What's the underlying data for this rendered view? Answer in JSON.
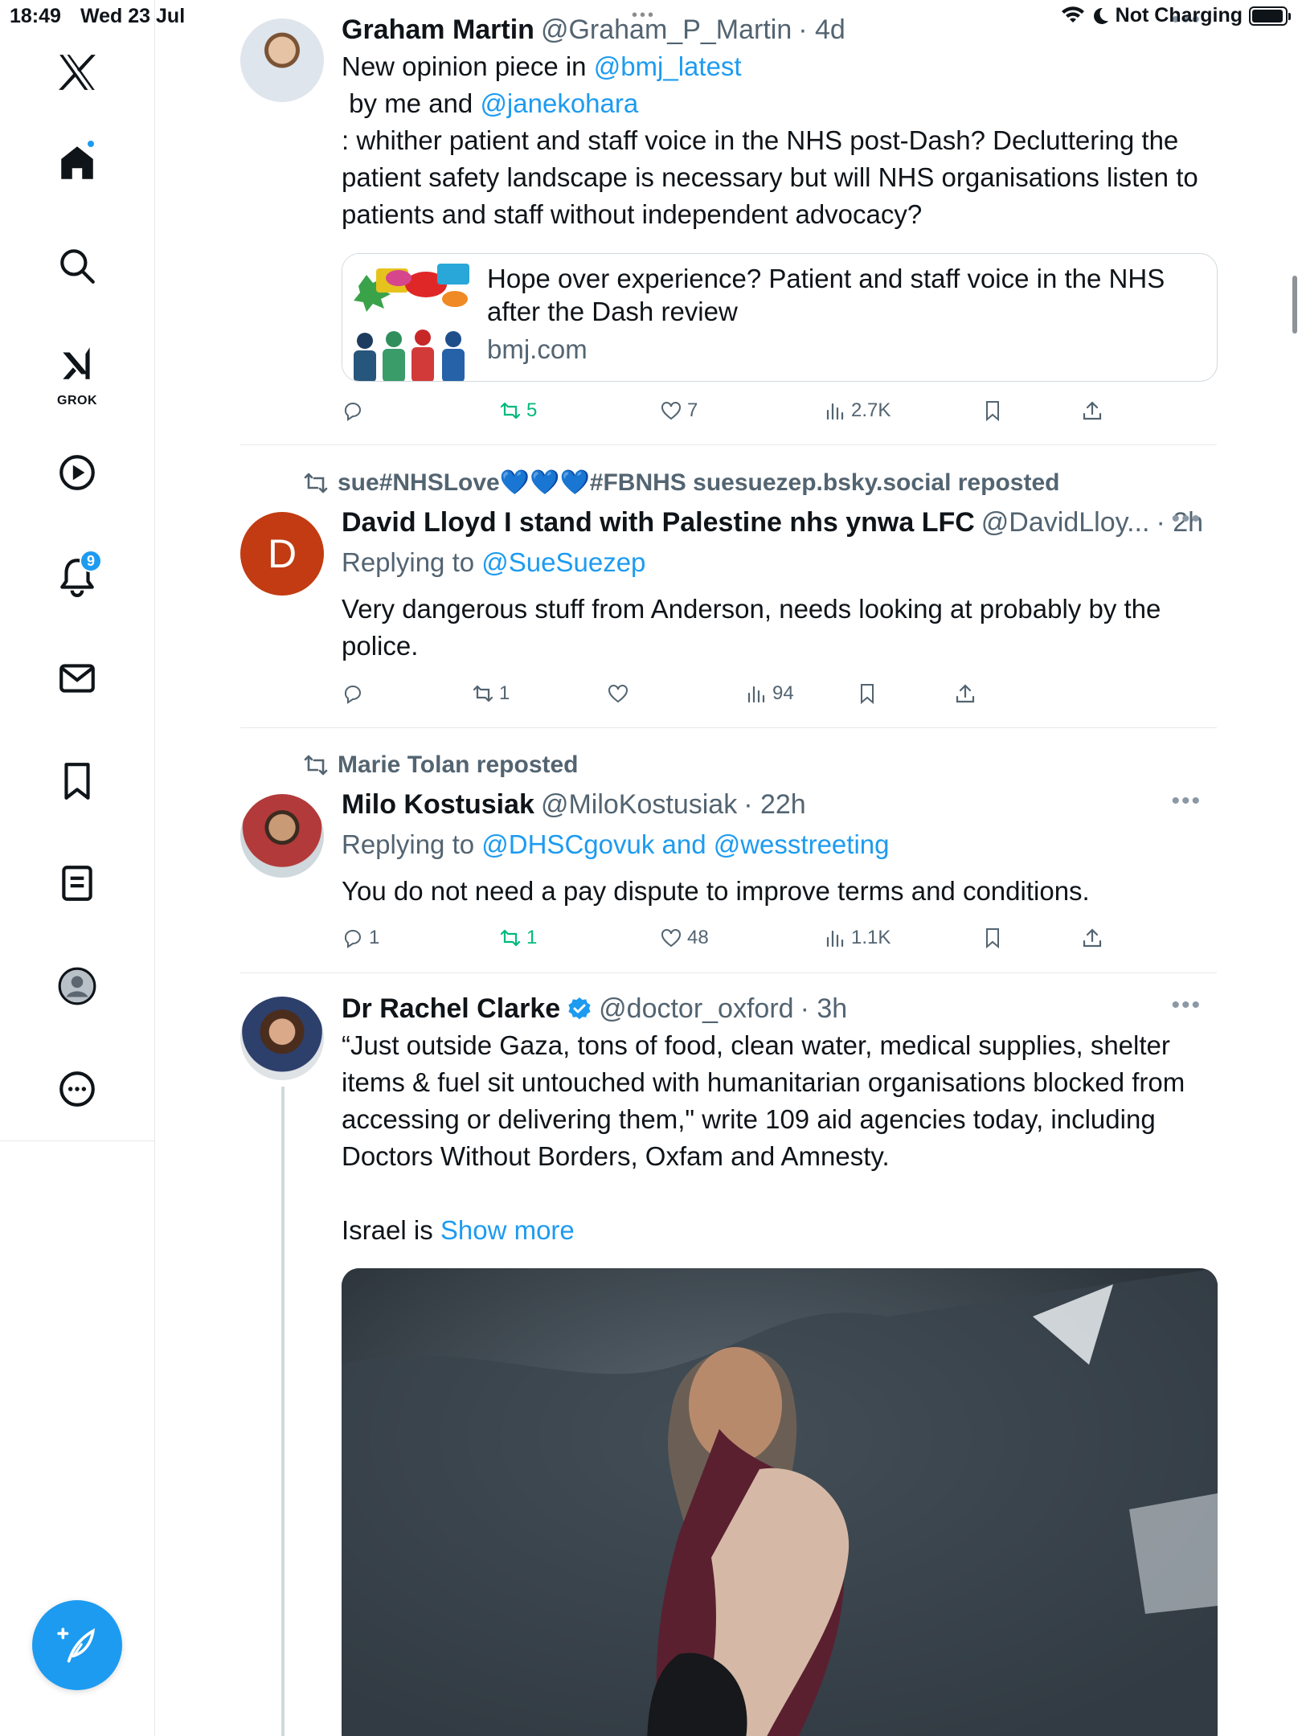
{
  "status_bar": {
    "time": "18:49",
    "date": "Wed 23 Jul",
    "charging": "Not Charging",
    "battery_level": 0.95
  },
  "sidebar": {
    "logo": "x-logo-icon",
    "items": [
      {
        "name": "home",
        "icon": "home-icon",
        "has_dot": true
      },
      {
        "name": "search",
        "icon": "search-icon"
      },
      {
        "name": "grok",
        "icon": "grok-icon",
        "label": "GROK"
      },
      {
        "name": "video",
        "icon": "play-icon"
      },
      {
        "name": "notifications",
        "icon": "bell-icon",
        "badge": "9"
      },
      {
        "name": "messages",
        "icon": "mail-icon"
      },
      {
        "name": "bookmarks",
        "icon": "bookmark-icon"
      },
      {
        "name": "lists",
        "icon": "list-icon"
      },
      {
        "name": "profile",
        "icon": "profile-icon"
      },
      {
        "name": "more",
        "icon": "more-circle-icon"
      }
    ],
    "compose_icon": "compose-icon"
  },
  "tweets": [
    {
      "name": "Graham Martin",
      "handle": "@Graham_P_Martin",
      "time": "· 4d",
      "line1_prefix": "New opinion piece in ",
      "line1_link": "@bmj_latest",
      "line2_prefix": " by me and ",
      "line2_link": "@janekohara",
      "body": ": whither patient and staff voice in the NHS post-Dash? Decluttering the patient safety landscape is necessary but will NHS organisations listen to patients and staff without independent advocacy?",
      "card": {
        "title": "Hope over experience? Patient and staff voice in the NHS after the Dash review",
        "domain": "bmj.com"
      },
      "reply_count": "",
      "repost_count": "5",
      "like_count": "7",
      "view_count": "2.7K"
    },
    {
      "reposted_by": "sue#NHSLove💙💙💙#FBNHS suesuezep.bsky.social reposted",
      "name": "David Lloyd I stand with Palestine nhs ynwa LFC",
      "handle": "@DavidLloy...",
      "time": "· 2h",
      "avatar_letter": "D",
      "replying_prefix": "Replying to ",
      "replying_to": "@SueSuezep",
      "body": "Very dangerous stuff from Anderson, needs looking at  probably by the police.",
      "reply_count": "",
      "repost_count": "1",
      "like_count": "",
      "view_count": "94"
    },
    {
      "reposted_by": "Marie Tolan reposted",
      "name": "Milo Kostusiak",
      "handle": "@MiloKostusiak",
      "time": "· 22h",
      "replying_prefix": "Replying to ",
      "replying_to": "@DHSCgovuk and @wesstreeting",
      "body": "You do not need a pay dispute to improve terms and conditions.",
      "reply_count": "1",
      "repost_count": "1",
      "like_count": "48",
      "view_count": "1.1K"
    },
    {
      "name": "Dr Rachel Clarke",
      "handle": "@doctor_oxford",
      "time": "· 3h",
      "verified": true,
      "body": "“Just outside Gaza, tons of food, clean water, medical supplies, shelter items & fuel sit untouched with humanitarian organisations blocked from accessing or delivering them,\" write 109 aid agencies today, including Doctors Without Borders, Oxfam and Amnesty.",
      "body2": "Israel is ",
      "show_more": "Show more"
    }
  ],
  "colors": {
    "accent": "#1d9bf0",
    "repost_green": "#00ba7c",
    "secondary_text": "#536471",
    "avatar_d": "#c23b12"
  }
}
